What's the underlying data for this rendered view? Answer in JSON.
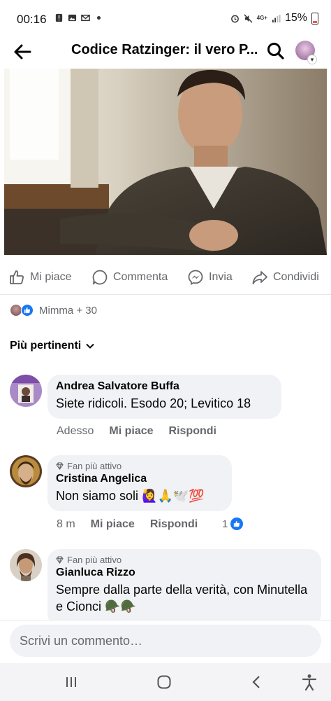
{
  "status_bar": {
    "time": "00:16",
    "battery": "15%",
    "network": "4G+",
    "icons": [
      "alert-icon",
      "image-icon",
      "gmail-icon",
      "dot-icon",
      "alarm-icon",
      "mute-icon",
      "signal-icon",
      "battery-icon"
    ]
  },
  "header": {
    "title": "Codice Ratzinger: il vero P...",
    "back_icon": "arrow-left-icon",
    "search_icon": "search-icon"
  },
  "post_actions": {
    "like": "Mi piace",
    "comment": "Commenta",
    "send": "Invia",
    "share": "Condividi"
  },
  "reactions": {
    "summary": "Mimma + 30"
  },
  "sort": {
    "label": "Più pertinenti"
  },
  "comments": [
    {
      "name": "Andrea Salvatore Buffa",
      "text": "Siete ridicoli. Esodo 20; Levitico 18",
      "time": "Adesso",
      "like_label": "Mi piace",
      "reply_label": "Rispondi"
    },
    {
      "badge": "Fan più attivo",
      "name": "Cristina Angelica",
      "text": "Non siamo soli 🙋‍♀️🙏🕊️💯",
      "time": "8 m",
      "like_label": "Mi piace",
      "reply_label": "Rispondi",
      "likes": "1"
    },
    {
      "badge": "Fan più attivo",
      "name": "Gianluca Rizzo",
      "text": "Sempre dalla parte della verità, con Minutella e Cionci 🪖🪖"
    }
  ],
  "composer": {
    "placeholder": "Scrivi un commento…"
  },
  "colors": {
    "accent": "#1877f2",
    "bubble": "#f0f2f5",
    "muted_text": "#65676b"
  }
}
